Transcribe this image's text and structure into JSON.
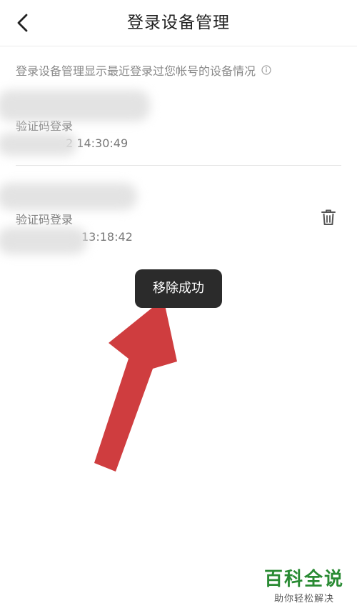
{
  "header": {
    "title": "登录设备管理"
  },
  "description": {
    "text": "登录设备管理显示最近登录过您帐号的设备情况"
  },
  "devices": [
    {
      "name": "",
      "method": "验证码登录",
      "time_visible": "2 14:30:49"
    },
    {
      "name": "",
      "method": "验证码登录",
      "time_visible": "13:18:42"
    }
  ],
  "toast": {
    "message": "移除成功"
  },
  "watermark": {
    "title": "百科全说",
    "subtitle": "助你轻松解决"
  },
  "colors": {
    "accent_arrow": "#cf3d3f",
    "toast_bg": "#2b2b2b",
    "watermark_green": "#2a8b34"
  },
  "icons": {
    "back": "chevron-left-icon",
    "info": "info-icon",
    "delete": "trash-icon"
  }
}
